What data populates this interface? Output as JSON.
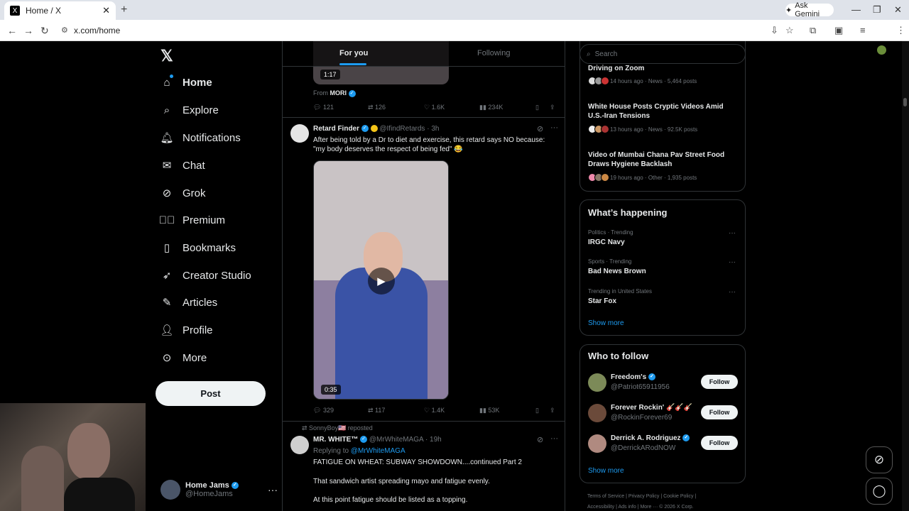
{
  "browser": {
    "tab_title": "Home / X",
    "tab_favicon": "X",
    "url": "x.com/home",
    "gemini_label": "Ask Gemini"
  },
  "logo": "𝕏",
  "nav": [
    {
      "label": "Home",
      "icon": "home-icon"
    },
    {
      "label": "Explore",
      "icon": "search-icon"
    },
    {
      "label": "Notifications",
      "icon": "bell-icon"
    },
    {
      "label": "Chat",
      "icon": "mail-icon"
    },
    {
      "label": "Grok",
      "icon": "grok-icon"
    },
    {
      "label": "Premium",
      "icon": "verified-icon"
    },
    {
      "label": "Bookmarks",
      "icon": "bookmark-icon"
    },
    {
      "label": "Creator Studio",
      "icon": "rocket-icon"
    },
    {
      "label": "Articles",
      "icon": "article-icon"
    },
    {
      "label": "Profile",
      "icon": "person-icon"
    },
    {
      "label": "More",
      "icon": "more-circle-icon"
    }
  ],
  "post_button": "Post",
  "account": {
    "name": "Home Jams",
    "handle": "@HomeJams"
  },
  "feed_tabs": {
    "for_you": "For you",
    "following": "Following"
  },
  "tweet1": {
    "duration": "1:17",
    "from_prefix": "From",
    "from": "MORI",
    "replies": "121",
    "reposts": "126",
    "likes": "1.6K",
    "views": "234K"
  },
  "tweet2": {
    "name": "Retard Finder",
    "handle": "@IfindRetards",
    "time": "· 3h",
    "text": "After being told by a Dr to diet and exercise, this retard says NO because: \"my body deserves the respect of being fed\" 😂",
    "duration": "0:35",
    "replies": "329",
    "reposts": "117",
    "likes": "1.4K",
    "views": "53K"
  },
  "tweet3": {
    "repost_by": "SonnyBoy🇺🇸 reposted",
    "name": "MR. WHITE™",
    "handle": "@MrWhiteMAGA",
    "time": "· 19h",
    "reply_prefix": "Replying to",
    "reply_to": "@MrWhiteMAGA",
    "line1": "FATIGUE ON WHEAT: SUBWAY SHOWDOWN....continued Part 2",
    "line2": "That sandwich artist spreading mayo and fatigue evenly.",
    "line3": "At this point fatigue should be listed as a topping."
  },
  "search_placeholder": "Search",
  "news": [
    {
      "title": "Driving on Zoom",
      "meta": "14 hours ago · News · 5,464 posts"
    },
    {
      "title": "White House Posts Cryptic Videos Amid U.S.-Iran Tensions",
      "meta": "13 hours ago · News · 92.5K posts"
    },
    {
      "title": "Video of Mumbai Chana Pav Street Food Draws Hygiene Backlash",
      "meta": "19 hours ago · Other · 1,935 posts"
    }
  ],
  "whats_happening": {
    "title": "What’s happening",
    "trends": [
      {
        "category": "Politics · Trending",
        "name": "IRGC Navy"
      },
      {
        "category": "Sports · Trending",
        "name": "Bad News Brown"
      },
      {
        "category": "Trending in United States",
        "name": "Star Fox"
      }
    ],
    "show_more": "Show more"
  },
  "who_to_follow": {
    "title": "Who to follow",
    "users": [
      {
        "name": "Freedom's",
        "handle": "@Patriot65911956",
        "button": "Follow"
      },
      {
        "name": "Forever Rockin' 🎸🎸🎸",
        "handle": "@RockinForever69",
        "button": "Follow"
      },
      {
        "name": "Derrick A. Rodriguez",
        "handle": "@DerrickARodNOW",
        "button": "Follow"
      }
    ],
    "show_more": "Show more"
  },
  "footer": {
    "line1": "Terms of Service  |  Privacy Policy  |  Cookie Policy  |",
    "line2": "Accessibility  |  Ads info  |  More ···  © 2026 X Corp."
  },
  "colors": {
    "accent": "#1d9bf0",
    "background": "#000000",
    "border": "#2f3336"
  }
}
